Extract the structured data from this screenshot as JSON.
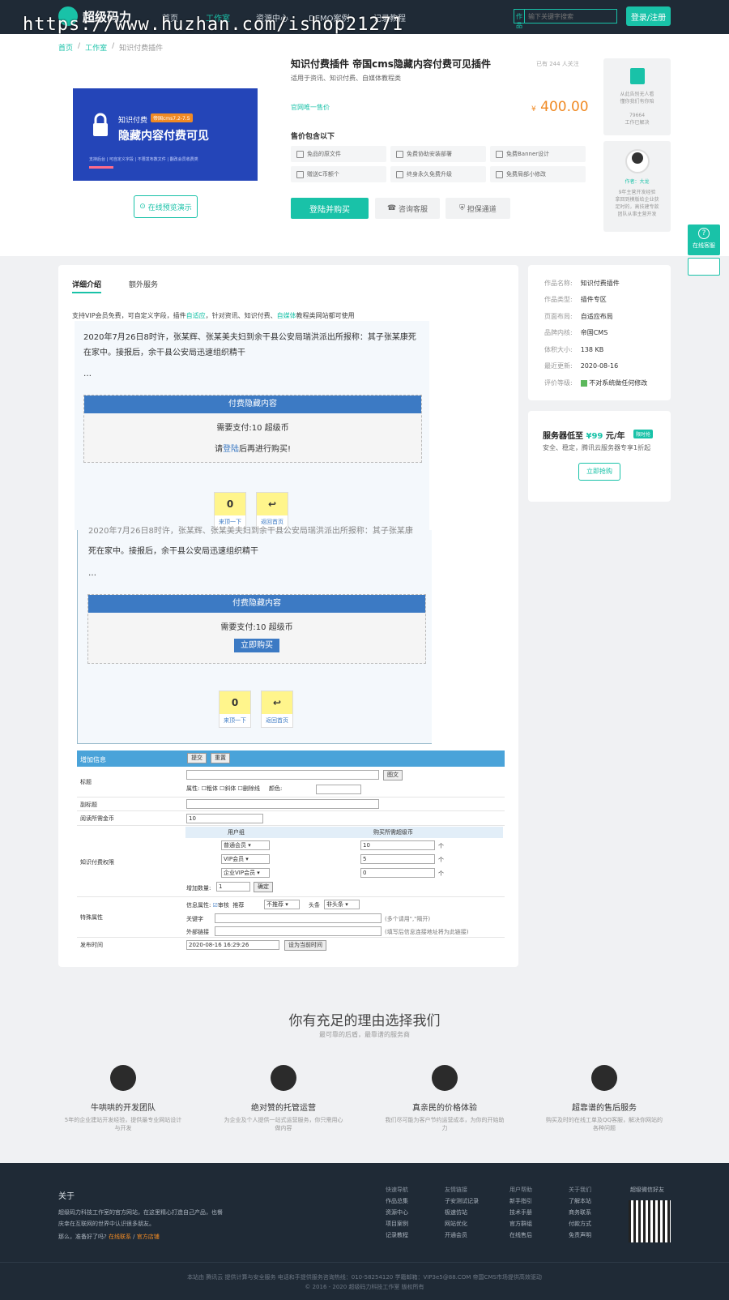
{
  "header": {
    "logo": "超级码力",
    "nav": [
      "首页",
      "工作室",
      "资源中心",
      "DEMO案例",
      "记录教程"
    ],
    "search_select": "作品",
    "search_placeholder": "输下关键字搜索",
    "login": "登录/注册"
  },
  "watermark": "https://www.huzhan.com/ishop21271",
  "breadcrumb": [
    "首页",
    "工作室",
    "知识付费插件"
  ],
  "product": {
    "title": "知识付费插件 帝国cms隐藏内容付费可见插件",
    "watch": "已有 244 人关注",
    "subtitle": "适用于资讯、知识付费、自媒体教程类",
    "price_label": "官网唯一售价",
    "currency": "¥",
    "price": "400.00",
    "includes_label": "售价包含以下",
    "features": [
      "免品的原文件",
      "免费协助安装部署",
      "免费Banner设计",
      "赠送C币额个",
      "终身永久免费升级",
      "免费局部小修改"
    ],
    "buy": "登陆并购买",
    "consult": "咨询客服",
    "guarantee": "担保通道",
    "preview": "在线预览演示"
  },
  "banner": {
    "t1": "知识付费",
    "badge": "帝国cms7.2-7.5",
    "t2": "隐藏内容付费可见",
    "t3": "支持后台 | 可自定义字段 | 不限发布数文件 | 翻改会员收费类"
  },
  "side": {
    "box1": [
      "从此告别无人看",
      "懂你我们有你陪",
      "79664",
      "工作已解决"
    ],
    "author": "作者：大龙",
    "author_desc": [
      "9年主营开发经验",
      "拿回到模版给企业获",
      "足时的，高技建专款",
      "团队从事主营开发"
    ]
  },
  "float": {
    "label": "在线客服"
  },
  "tabs": [
    "详细介绍",
    "额外服务"
  ],
  "intro": {
    "a": "支持VIP会员免费，可自定义字段，插件",
    "l1": "自适应",
    "b": "，针对资讯、知识付费、",
    "l2": "自媒体",
    "c": "教程类网站都可使用"
  },
  "demo": {
    "story": "2020年7月26日8时许，张某辉、张某美夫妇到余干县公安局瑞洪派出所报称：其子张某康死在家中。接报后，余干县公安局迅速组织精干",
    "ellipsis": "…",
    "hidden_title": "付费隐藏内容",
    "pay": "需要支付:10 超级币",
    "login_pre": "请",
    "login_link": "登陆",
    "login_post": "后再进行购买!",
    "buy_now": "立即购买",
    "thumb_up": "0",
    "thumb_back": "↩",
    "label_up": "来顶一下",
    "label_back": "返回首页",
    "story2a": "2020年7月26日8时许，张某辉、张某美夫妇到余干县公安局瑞洪派出所报称：其子张某康",
    "story2b": "死在家中。接报后，余干县公安局迅速组织精干"
  },
  "form": {
    "header": "增加信息",
    "submit": "提交",
    "reset": "重置",
    "title_label": "标题",
    "image_btn": "图文",
    "attr_label": "属性:",
    "bold": "粗体",
    "italic": "斜体",
    "strike": "删除线",
    "color": "颜色:",
    "subtitle": "副标题",
    "read_label": "阅读所需金币",
    "read_val": "10",
    "perm_label": "知识付费权限",
    "group_col": "用户组",
    "coin_col": "购买所需超级币",
    "groups": [
      "普通会员",
      "VIP会员",
      "企业VIP会员"
    ],
    "coins": [
      "10",
      "5",
      "0"
    ],
    "unit": "个",
    "add_count": "增加数量:",
    "add_val": "1",
    "confirm": "确定",
    "special": "特殊属性",
    "info_attr": "信息属性:",
    "audit": "审核",
    "recommend": "推荐",
    "rec_val": "不推荐",
    "headline": "头条",
    "head_val": "非头条",
    "keyword": "关键字",
    "keyword_hint": "(多个请用\",\"隔开)",
    "ext_link": "外部链接",
    "ext_hint": "(填写后信息连接地址将为此链接)",
    "pubtime": "发布时间",
    "pub_val": "2020-08-16 16:29:26",
    "set_now": "设为当前时间"
  },
  "info": {
    "rows": [
      [
        "作品名称:",
        "知识付费插件"
      ],
      [
        "作品类型:",
        "插件专区"
      ],
      [
        "页面布局:",
        "自适应布局"
      ],
      [
        "品牌内核:",
        "帝国CMS"
      ],
      [
        "体积大小:",
        "138 KB"
      ],
      [
        "最近更新:",
        "2020-08-16"
      ],
      [
        "评价等级:",
        "不对系统做任何修改"
      ]
    ]
  },
  "server": {
    "title": "服务器低至",
    "price": "¥99",
    "unit": "元/年",
    "tag": "限时抢",
    "desc": "安全、稳定，腾讯云服务器专享1折起",
    "btn": "立即抢购"
  },
  "reasons": {
    "title": "你有充足的理由选择我们",
    "sub": "最可靠的后盾，最靠谱的服务商",
    "items": [
      {
        "t": "牛哄哄的开发团队",
        "d": "5年的企业建站开发经验，提供最专业网站设计与开发"
      },
      {
        "t": "绝对赞的托管运营",
        "d": "为企业及个人提供一站式运营服务，你只需用心做内容"
      },
      {
        "t": "真亲民的价格体验",
        "d": "我们尽可能为客户节约运营成本，为你的开始助力"
      },
      {
        "t": "超靠谱的售后服务",
        "d": "购买及时的在线工单及QQ客服，解决你网站的各种问题"
      }
    ]
  },
  "footer": {
    "about": "关于",
    "about_text": [
      "超级码力科技工作室的官方网站，在这里精心打造自己产品，也餐",
      "庆幸在互联网的世界中认识很多朋友。"
    ],
    "ready": "那么，准备好了吗?",
    "online": "在线联系",
    "shop": "官方店铺",
    "cols": [
      {
        "h": "快速导航",
        "items": [
          "作品总集",
          "资源中心",
          "项目案例",
          "记录教程"
        ]
      },
      {
        "h": "友情链接",
        "items": [
          "子安测试记录",
          "极速仿站",
          "网站优化",
          "开通会员"
        ]
      },
      {
        "h": "用户帮助",
        "items": [
          "新手指引",
          "技术手册",
          "官方群组",
          "在线售后"
        ]
      },
      {
        "h": "关于我们",
        "items": [
          "了解本站",
          "商务联系",
          "付款方式",
          "免责声明"
        ]
      }
    ],
    "wechat": "超级微信好友",
    "copy1": "本站由 腾讯云 提供计算与安全服务 电话和手提供服务咨询热线：010-58254120 学籍邮箱：VIP3e5@88.COM 帝国CMS市场提供高效驱动",
    "copy2": "© 2016 - 2020 超级码力科技工作室 版权所有"
  }
}
